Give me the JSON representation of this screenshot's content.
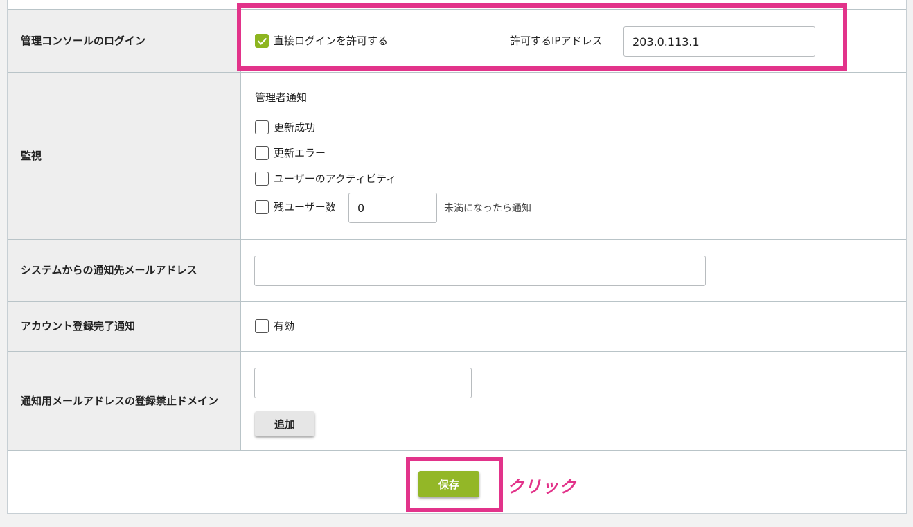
{
  "rows": {
    "console_login": {
      "label": "管理コンソールのログイン",
      "direct_login_label": "直接ログインを許可する",
      "direct_login_checked": true,
      "ip_label": "許可するIPアドレス",
      "ip_value": "203.0.113.1"
    },
    "monitoring": {
      "label": "監視",
      "section_title": "管理者通知",
      "options": [
        {
          "label": "更新成功",
          "checked": false
        },
        {
          "label": "更新エラー",
          "checked": false
        },
        {
          "label": "ユーザーのアクティビティ",
          "checked": false
        }
      ],
      "remaining_users_label": "残ユーザー数",
      "remaining_users_value": "0",
      "remaining_users_suffix": "未満になったら通知"
    },
    "system_email": {
      "label": "システムからの通知先メールアドレス",
      "value": ""
    },
    "account_registration": {
      "label": "アカウント登録完了通知",
      "enabled_label": "有効",
      "checked": false
    },
    "banned_domains": {
      "label": "通知用メールアドレスの登録禁止ドメイン",
      "value": "",
      "add_button": "追加"
    }
  },
  "save_button": "保存",
  "annotation": "クリック",
  "colors": {
    "accent_green": "#93b727",
    "highlight_pink": "#e2338a"
  }
}
